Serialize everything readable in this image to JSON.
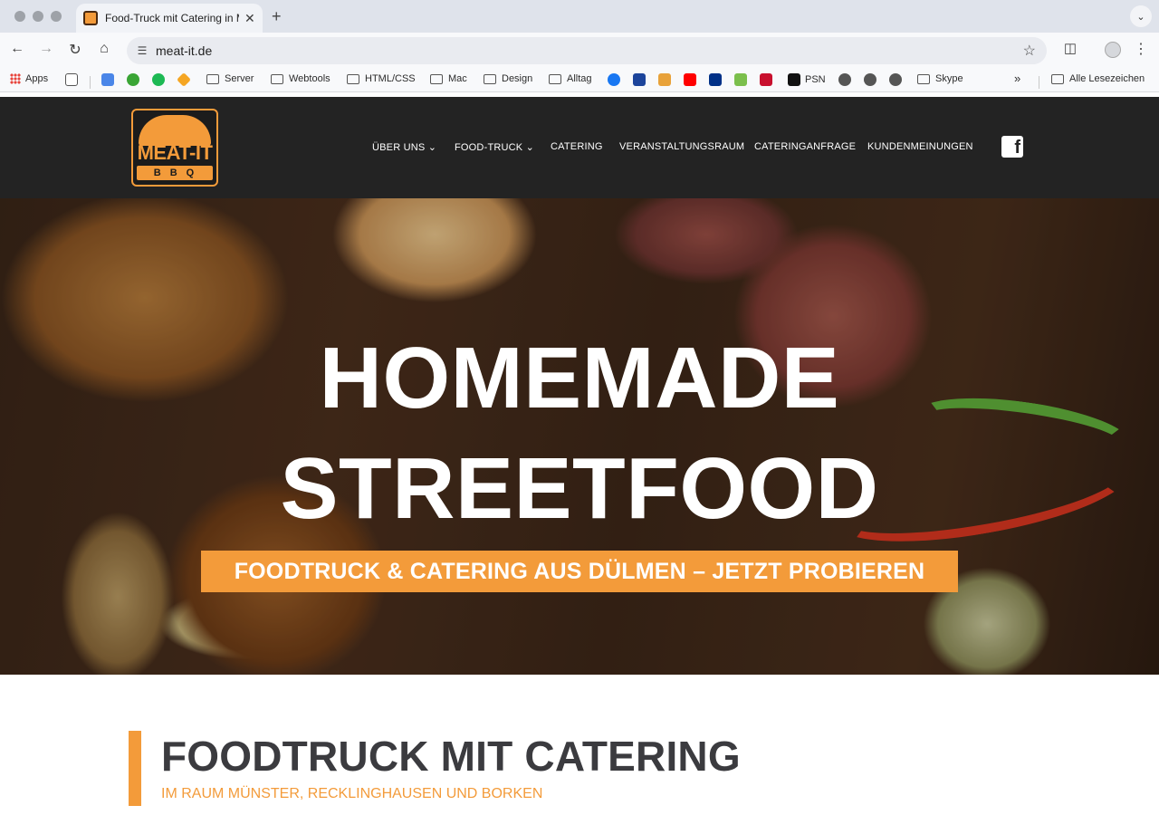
{
  "browser": {
    "tab_title": "Food-Truck mit Catering in Mü",
    "tab_close": "✕",
    "new_tab": "+",
    "url": "meat-it.de"
  },
  "bookmarks": {
    "apps_label": "Apps",
    "items": [
      {
        "label": "",
        "icon": "calendar-icon"
      },
      {
        "label": "",
        "icon": "1password-icon"
      },
      {
        "label": "",
        "icon": "spotify-icon"
      },
      {
        "label": "",
        "icon": "bookmark-orange-icon"
      },
      {
        "label": "Server",
        "icon": "folder-icon"
      },
      {
        "label": "Webtools",
        "icon": "folder-icon"
      },
      {
        "label": "HTML/CSS",
        "icon": "folder-icon"
      },
      {
        "label": "Mac",
        "icon": "folder-icon"
      },
      {
        "label": "Design",
        "icon": "folder-icon"
      },
      {
        "label": "Alltag",
        "icon": "folder-icon"
      },
      {
        "label": "PSN",
        "icon": "s-icon"
      },
      {
        "label": "Skype",
        "icon": "folder-icon"
      }
    ],
    "overflow": "»",
    "all_bookmarks": "Alle Lesezeichen"
  },
  "site": {
    "logo_main": "MEAT-IT",
    "logo_sub": "BBQ",
    "nav": [
      {
        "label": "ÜBER UNS ⌄"
      },
      {
        "label": "FOOD-TRUCK ⌄"
      },
      {
        "label": "CATERING"
      },
      {
        "label": "VERANSTALTUNGSRAUM"
      },
      {
        "label": "CATERINGANFRAGE"
      },
      {
        "label": "KUNDENMEINUNGEN"
      }
    ],
    "facebook_glyph": "f"
  },
  "hero": {
    "title_line1": "HOMEMADE",
    "title_line2": "STREETFOOD",
    "cta": "FOODTRUCK & CATERING AUS DÜLMEN – JETZT PROBIEREN"
  },
  "section": {
    "title": "FOODTRUCK MIT CATERING",
    "subtitle": "IM RAUM MÜNSTER, RECKLINGHAUSEN UND BORKEN"
  },
  "colors": {
    "accent": "#f39b3a",
    "header_bg": "#232323",
    "heading": "#3b3b3f"
  }
}
